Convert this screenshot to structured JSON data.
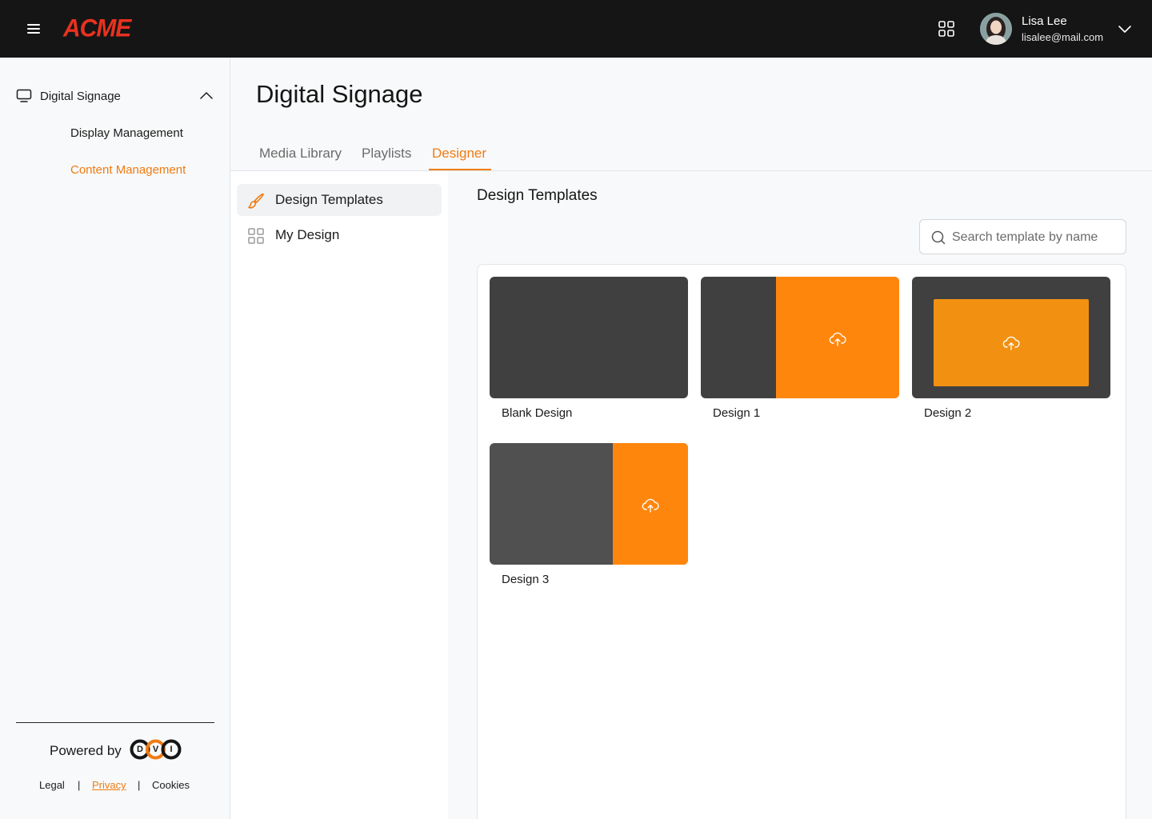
{
  "header": {
    "logo_text": "ACME",
    "user": {
      "name": "Lisa Lee",
      "email": "lisalee@mail.com"
    }
  },
  "sidebar": {
    "parent_label": "Digital Signage",
    "items": [
      {
        "label": "Display Management",
        "active": false
      },
      {
        "label": "Content Management",
        "active": true
      }
    ],
    "powered_by": "Powered by",
    "brand_letters": [
      "D",
      "V",
      "I"
    ],
    "footer": {
      "legal": "Legal",
      "privacy": "Privacy",
      "cookies": "Cookies",
      "separator": "|"
    }
  },
  "main": {
    "title": "Digital Signage",
    "tabs": [
      {
        "label": "Media Library",
        "active": false
      },
      {
        "label": "Playlists",
        "active": false
      },
      {
        "label": "Designer",
        "active": true
      }
    ]
  },
  "subnav": {
    "items": [
      {
        "label": "Design Templates",
        "icon": "paintbrush-icon",
        "active": true
      },
      {
        "label": "My Design",
        "icon": "grid-icon",
        "active": false
      }
    ]
  },
  "content": {
    "section_title": "Design Templates",
    "search_placeholder": "Search template by name",
    "templates": [
      {
        "label": "Blank Design"
      },
      {
        "label": "Design 1"
      },
      {
        "label": "Design 2"
      },
      {
        "label": "Design 3"
      }
    ]
  },
  "colors": {
    "accent": "#f07b12",
    "topbar": "#151515",
    "logo": "#e8321f",
    "thumb_dark": "#404040",
    "thumb_orange": "#ff860d"
  }
}
